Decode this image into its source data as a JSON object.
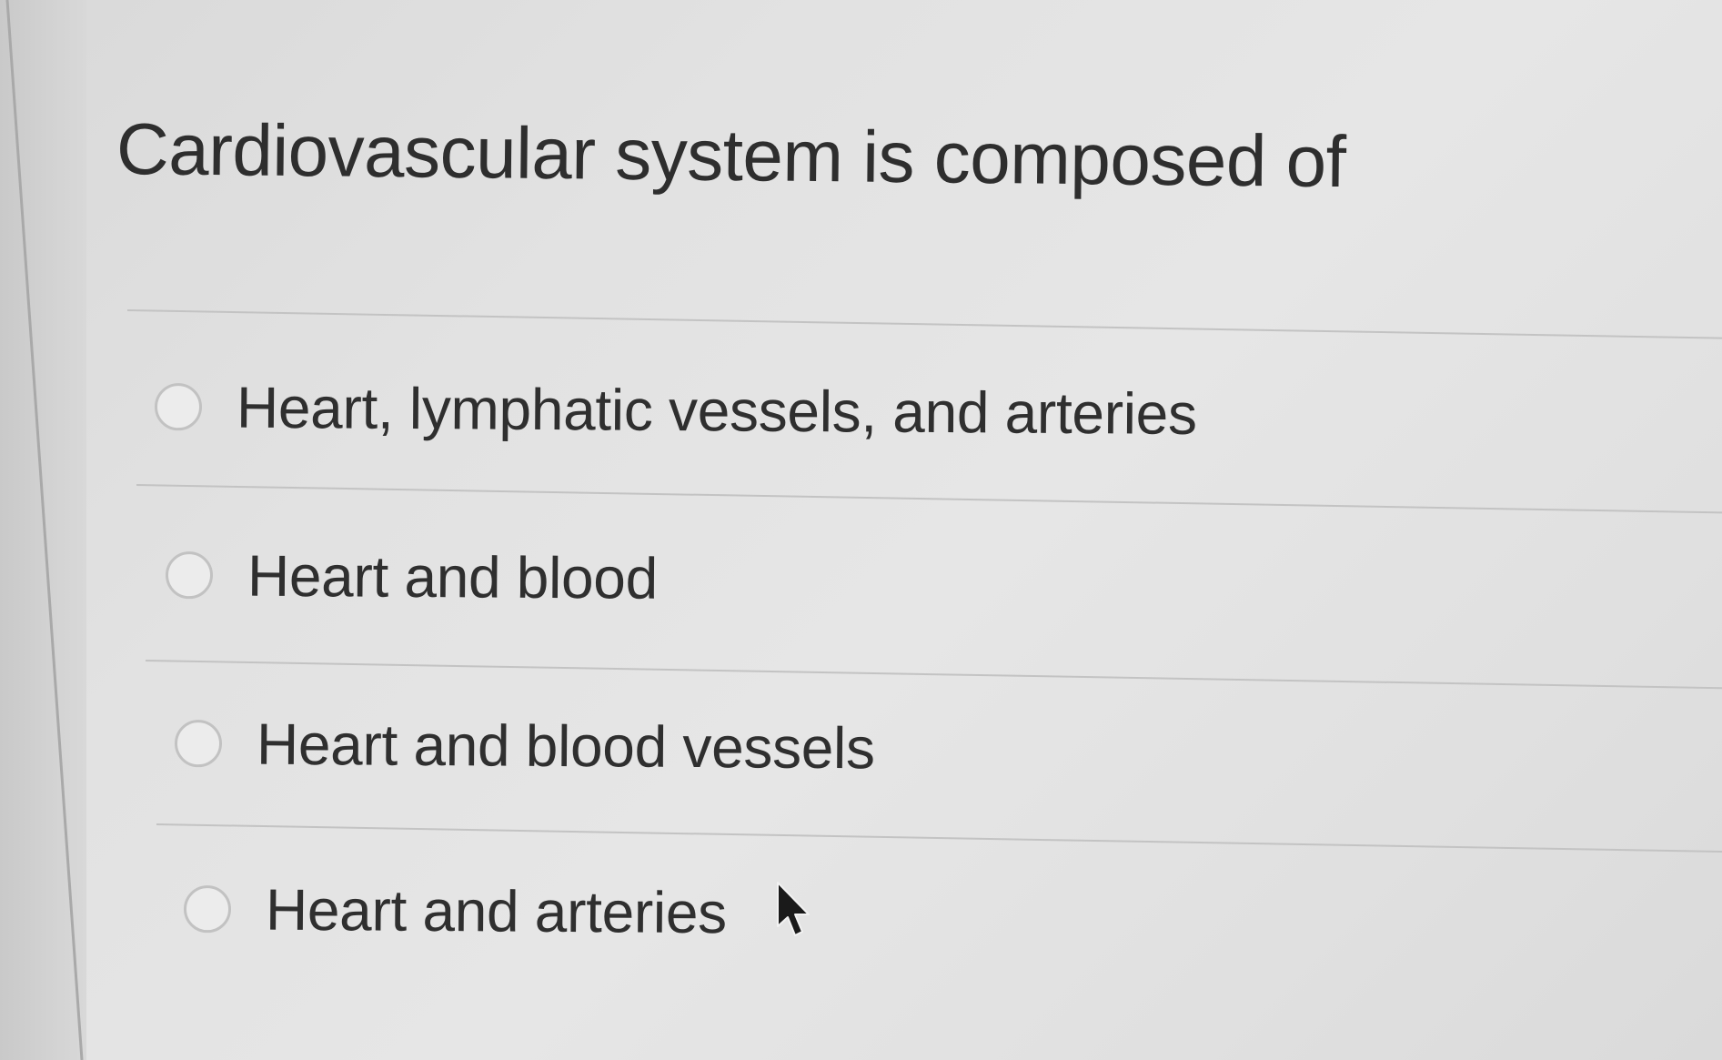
{
  "question": {
    "text": "Cardiovascular system is composed of"
  },
  "options": [
    {
      "label": "Heart, lymphatic vessels, and arteries",
      "selected": false
    },
    {
      "label": "Heart and blood",
      "selected": false
    },
    {
      "label": "Heart and blood vessels",
      "selected": false
    },
    {
      "label": "Heart and arteries",
      "selected": false
    }
  ],
  "icons": {
    "cursor": "mouse-pointer-icon",
    "radio": "radio-unchecked-icon"
  },
  "colors": {
    "background": "#e2e2e2",
    "text": "#2e2e2e",
    "divider": "#c3c3c3"
  }
}
